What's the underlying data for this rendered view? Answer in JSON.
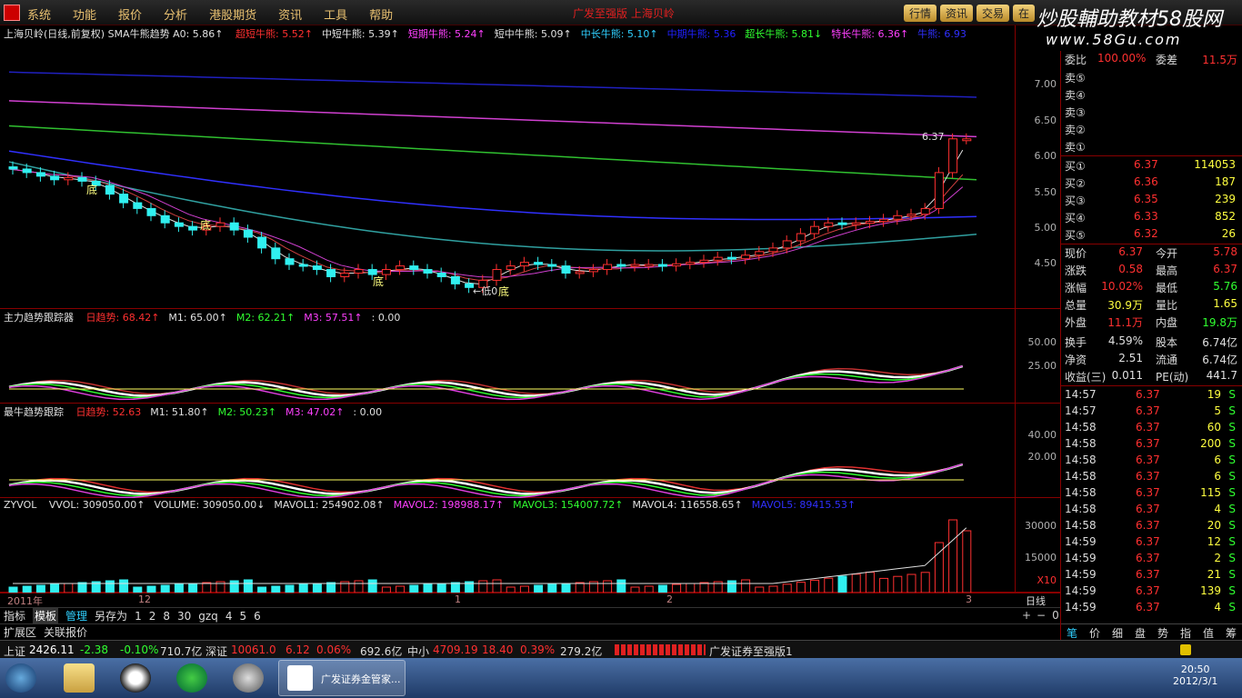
{
  "menubar": {
    "items": [
      "系统",
      "功能",
      "报价",
      "分析",
      "港股期货",
      "资讯",
      "工具",
      "帮助"
    ],
    "center_title": "广发至强版  上海贝岭",
    "buttons": [
      "行情",
      "资讯",
      "交易",
      "在"
    ],
    "watermark": "炒股輔助教材58股网",
    "watermark_url": "www.58Gu.com"
  },
  "main_pane": {
    "title": "上海贝岭(日线,前复权) SMA牛熊趋势 A0: 5.86↑",
    "labels": [
      {
        "text": "超短牛熊: 5.52↑",
        "color": "#ff3030"
      },
      {
        "text": "中短牛熊: 5.39↑",
        "color": "#e0e0e0"
      },
      {
        "text": "短期牛熊: 5.24↑",
        "color": "#ff40ff"
      },
      {
        "text": "短中牛熊: 5.09↑",
        "color": "#e0e0e0"
      },
      {
        "text": "中长牛熊: 5.10↑",
        "color": "#30d0ff"
      },
      {
        "text": "中期牛熊: 5.36",
        "color": "#2020ff"
      },
      {
        "text": "超长牛熊: 5.81↓",
        "color": "#30ff30"
      },
      {
        "text": "特长牛熊: 6.36↑",
        "color": "#ff40ff"
      },
      {
        "text": "牛熊: 6.93",
        "color": "#3030ff"
      }
    ],
    "axis": [
      "7.00",
      "6.50",
      "6.00",
      "5.50",
      "5.00",
      "4.50"
    ],
    "annotations": [
      "底",
      "底",
      "底",
      "底",
      "低0",
      "6.37"
    ]
  },
  "pane2": {
    "title": "主力趋势跟踪器",
    "values": [
      {
        "text": "日趋势: 68.42↑",
        "color": "#ff3030"
      },
      {
        "text": "M1: 65.00↑",
        "color": "#e0e0e0"
      },
      {
        "text": "M2: 62.21↑",
        "color": "#30ff30"
      },
      {
        "text": "M3: 57.51↑",
        "color": "#ff40ff"
      },
      {
        "text": ": 0.00",
        "color": "#e0e0e0"
      }
    ],
    "axis": [
      "50.00",
      "25.00"
    ]
  },
  "pane3": {
    "title": "最牛趋势跟踪",
    "values": [
      {
        "text": "日趋势: 52.63",
        "color": "#ff3030"
      },
      {
        "text": "M1: 51.80↑",
        "color": "#e0e0e0"
      },
      {
        "text": "M2: 50.23↑",
        "color": "#30ff30"
      },
      {
        "text": "M3: 47.02↑",
        "color": "#ff40ff"
      },
      {
        "text": ": 0.00",
        "color": "#e0e0e0"
      }
    ],
    "axis": [
      "40.00",
      "20.00"
    ]
  },
  "pane4": {
    "title": "ZYVOL",
    "values": [
      {
        "text": "VVOL: 309050.00↑",
        "color": "#e0e0e0"
      },
      {
        "text": "VOLUME: 309050.00↓",
        "color": "#e0e0e0"
      },
      {
        "text": "MAVOL1: 254902.08↑",
        "color": "#e0e0e0"
      },
      {
        "text": "MAVOL2: 198988.17↑",
        "color": "#ff40ff"
      },
      {
        "text": "MAVOL3: 154007.72↑",
        "color": "#30ff30"
      },
      {
        "text": "MAVOL4: 116558.65↑",
        "color": "#e0e0e0"
      },
      {
        "text": "MAVOL5: 89415.53↑",
        "color": "#3030ff"
      }
    ],
    "axis": [
      "30000",
      "15000"
    ],
    "unit": "X10"
  },
  "timeaxis": {
    "labels": [
      "2011年",
      "12",
      "1",
      "2",
      "3"
    ],
    "period": "日线"
  },
  "tabs_row1": {
    "items": [
      "指标",
      "模板",
      "管理",
      "另存为",
      "1",
      "2",
      "8",
      "30",
      "gzq",
      "4",
      "5",
      "6"
    ],
    "active": "模板",
    "controls": [
      "+",
      "−",
      "0"
    ]
  },
  "tabs_row2": {
    "items": [
      "扩展区",
      "关联报价"
    ]
  },
  "right_panel": {
    "weibi": {
      "label": "委比",
      "value": "100.00%",
      "label2": "委差",
      "value2": "11.5万"
    },
    "sell": [
      {
        "label": "卖⑤",
        "price": "",
        "vol": ""
      },
      {
        "label": "卖④",
        "price": "",
        "vol": ""
      },
      {
        "label": "卖③",
        "price": "",
        "vol": ""
      },
      {
        "label": "卖②",
        "price": "",
        "vol": ""
      },
      {
        "label": "卖①",
        "price": "",
        "vol": ""
      }
    ],
    "buy": [
      {
        "label": "买①",
        "price": "6.37",
        "vol": "114053"
      },
      {
        "label": "买②",
        "price": "6.36",
        "vol": "187"
      },
      {
        "label": "买③",
        "price": "6.35",
        "vol": "239"
      },
      {
        "label": "买④",
        "price": "6.33",
        "vol": "852"
      },
      {
        "label": "买⑤",
        "price": "6.32",
        "vol": "26"
      }
    ],
    "stats": [
      {
        "l1": "现价",
        "v1": "6.37",
        "c1": "#ff3030",
        "l2": "今开",
        "v2": "5.78",
        "c2": "#ff3030"
      },
      {
        "l1": "涨跌",
        "v1": "0.58",
        "c1": "#ff3030",
        "l2": "最高",
        "v2": "6.37",
        "c2": "#ff3030"
      },
      {
        "l1": "涨幅",
        "v1": "10.02%",
        "c1": "#ff3030",
        "l2": "最低",
        "v2": "5.76",
        "c2": "#30ff30"
      },
      {
        "l1": "总量",
        "v1": "30.9万",
        "c1": "#ffff40",
        "l2": "量比",
        "v2": "1.65",
        "c2": "#ffff40"
      },
      {
        "l1": "外盘",
        "v1": "11.1万",
        "c1": "#ff3030",
        "l2": "内盘",
        "v2": "19.8万",
        "c2": "#30ff30"
      },
      {
        "l1": "换手",
        "v1": "4.59%",
        "c1": "#e0e0e0",
        "l2": "股本",
        "v2": "6.74亿",
        "c2": "#e0e0e0"
      },
      {
        "l1": "净资",
        "v1": "2.51",
        "c1": "#e0e0e0",
        "l2": "流通",
        "v2": "6.74亿",
        "c2": "#e0e0e0"
      },
      {
        "l1": "收益(三)",
        "v1": "0.011",
        "c1": "#e0e0e0",
        "l2": "PE(动)",
        "v2": "441.7",
        "c2": "#e0e0e0"
      }
    ],
    "ticks": [
      {
        "time": "14:57",
        "price": "6.37",
        "vol": "19",
        "side": "S"
      },
      {
        "time": "14:57",
        "price": "6.37",
        "vol": "5",
        "side": "S"
      },
      {
        "time": "14:58",
        "price": "6.37",
        "vol": "60",
        "side": "S"
      },
      {
        "time": "14:58",
        "price": "6.37",
        "vol": "200",
        "side": "S"
      },
      {
        "time": "14:58",
        "price": "6.37",
        "vol": "6",
        "side": "S"
      },
      {
        "time": "14:58",
        "price": "6.37",
        "vol": "6",
        "side": "S"
      },
      {
        "time": "14:58",
        "price": "6.37",
        "vol": "115",
        "side": "S"
      },
      {
        "time": "14:58",
        "price": "6.37",
        "vol": "4",
        "side": "S"
      },
      {
        "time": "14:58",
        "price": "6.37",
        "vol": "20",
        "side": "S"
      },
      {
        "time": "14:59",
        "price": "6.37",
        "vol": "12",
        "side": "S"
      },
      {
        "time": "14:59",
        "price": "6.37",
        "vol": "2",
        "side": "S"
      },
      {
        "time": "14:59",
        "price": "6.37",
        "vol": "21",
        "side": "S"
      },
      {
        "time": "14:59",
        "price": "6.37",
        "vol": "139",
        "side": "S"
      },
      {
        "time": "14:59",
        "price": "6.37",
        "vol": "4",
        "side": "S"
      }
    ],
    "bottom_tabs": [
      "笔",
      "价",
      "细",
      "盘",
      "势",
      "指",
      "值",
      "筹"
    ]
  },
  "status": {
    "sh_label": "上证",
    "sh_val": "2426.11",
    "sh_chg": "-2.38",
    "sh_pct": "-0.10%",
    "sh_amt": "710.7亿",
    "sz_label": "深证",
    "sz_val": "10061.0",
    "sz_chg": "6.12",
    "sz_pct": "0.06%",
    "sz_amt": "692.6亿",
    "zx_label": "中小",
    "zx_val": "4709.19",
    "zx_chg": "18.40",
    "zx_pct": "0.39%",
    "zx_amt": "279.2亿",
    "product": "广发证券至强版1"
  },
  "taskbar": {
    "active_app": "广发证券金管家...",
    "time": "20:50",
    "date": "2012/3/1"
  }
}
